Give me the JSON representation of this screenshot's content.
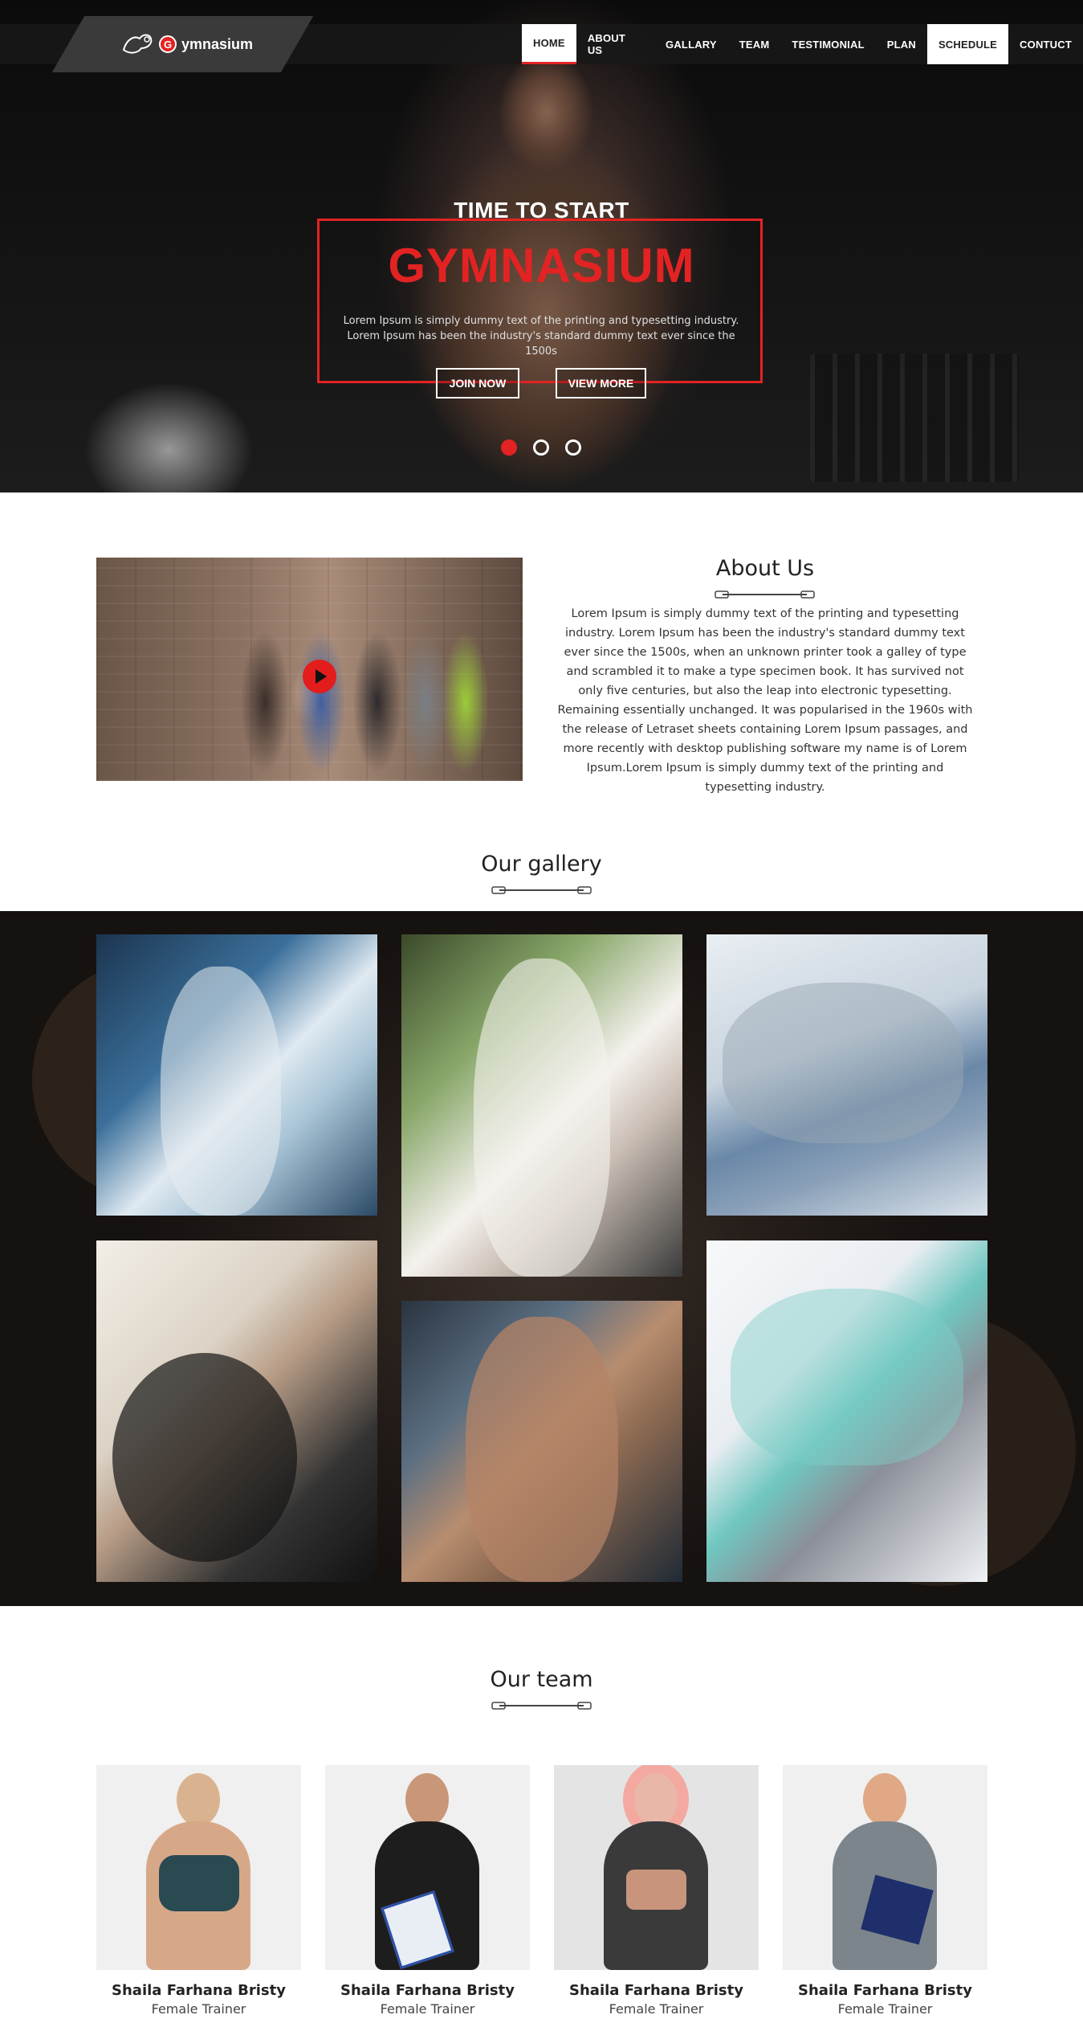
{
  "logo": {
    "letter": "G",
    "text": "ymnasium"
  },
  "nav": {
    "items": [
      "HOME",
      "ABOUT US",
      "GALLARY",
      "TEAM",
      "TESTIMONIAL",
      "PLAN",
      "SCHEDULE",
      "CONTUCT"
    ]
  },
  "hero": {
    "kicker": "TIME TO START",
    "title": "GYMNASIUM",
    "text": "Lorem Ipsum is simply dummy text of the printing and typesetting industry. Lorem Ipsum has been the industry's standard dummy text ever since the 1500s",
    "buttons": {
      "join": "JOIN NOW",
      "more": "VIEW MORE"
    },
    "slide_count": 3,
    "active_slide": 1
  },
  "about": {
    "title": "About Us",
    "text": "Lorem Ipsum is simply dummy text of the printing and typesetting industry. Lorem Ipsum has been the industry's standard dummy text ever since the 1500s, when an unknown printer took a galley of type and scrambled it to make a type specimen book. It has survived not only five centuries, but also the leap into electronic typesetting. Remaining essentially unchanged. It was popularised in the 1960s with the release of Letraset sheets containing Lorem Ipsum passages, and more recently with desktop publishing software my name is of Lorem Ipsum.Lorem Ipsum is simply dummy text of the printing and typesetting industry."
  },
  "gallery": {
    "title": "Our gallery"
  },
  "team": {
    "title": "Our team",
    "members": [
      {
        "name": "Shaila Farhana Bristy",
        "role": "Female Trainer"
      },
      {
        "name": "Shaila Farhana Bristy",
        "role": "Female Trainer"
      },
      {
        "name": "Shaila Farhana Bristy",
        "role": "Female Trainer"
      },
      {
        "name": "Shaila Farhana Bristy",
        "role": "Female Trainer"
      }
    ]
  },
  "colors": {
    "accent": "#e32323",
    "dark": "#111111"
  }
}
